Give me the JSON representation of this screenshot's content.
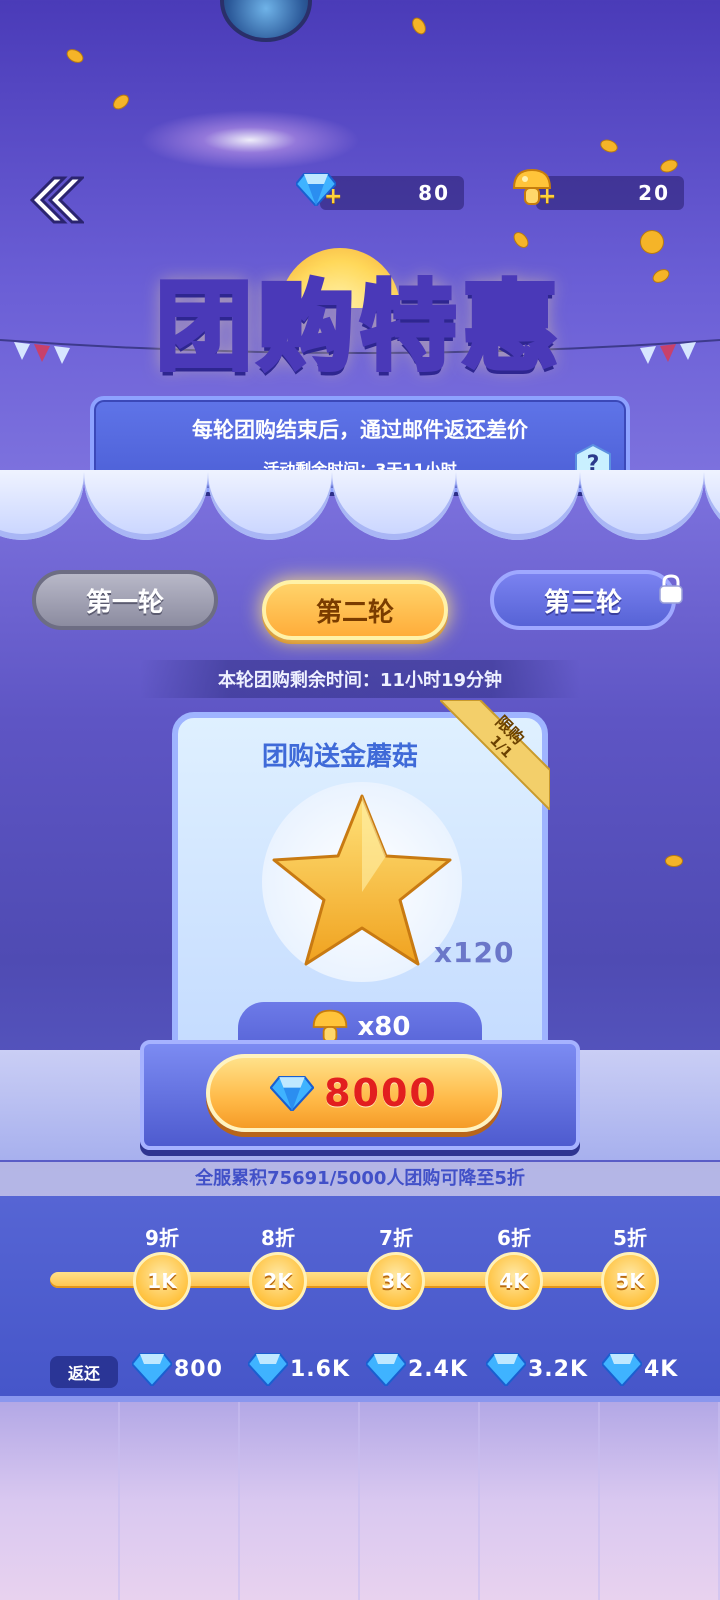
{
  "header": {
    "back_icon": "double-chevron-left-icon",
    "gems": {
      "icon": "blue-gem-icon",
      "value": "80"
    },
    "mushrooms": {
      "icon": "gold-mushroom-icon",
      "value": "20"
    }
  },
  "banner": {
    "title": "团购特惠",
    "subtitle": "每轮团购结束后，通过邮件返还差价",
    "remaining": "活动剩余时间：3天11小时",
    "help_label": "?"
  },
  "rounds": [
    {
      "label": "第一轮",
      "state": "past"
    },
    {
      "label": "第二轮",
      "state": "active"
    },
    {
      "label": "第三轮",
      "state": "locked"
    }
  ],
  "round_timer": "本轮团购剩余时间：11小时19分钟",
  "card": {
    "title": "团购送金蘑菇",
    "limit_label": "限购",
    "limit_count": "1/1",
    "item_icon": "gold-star-icon",
    "item_qty": "x120",
    "bonus_icon": "gold-mushroom-icon",
    "bonus_qty": "x80",
    "price_icon": "blue-gem-icon",
    "price": "8000"
  },
  "progress_text": "全服累积75691/5000人团购可降至5折",
  "tiers": [
    {
      "discount": "9折",
      "threshold": "1K",
      "refund": "800"
    },
    {
      "discount": "8折",
      "threshold": "2K",
      "refund": "1.6K"
    },
    {
      "discount": "7折",
      "threshold": "3K",
      "refund": "2.4K"
    },
    {
      "discount": "6折",
      "threshold": "4K",
      "refund": "3.2K"
    },
    {
      "discount": "5折",
      "threshold": "5K",
      "refund": "4K"
    }
  ],
  "refund_label": "返还",
  "colors": {
    "accent_gold": "#ffc24a",
    "price_red": "#e21f1f",
    "panel_blue": "#4656c9"
  }
}
